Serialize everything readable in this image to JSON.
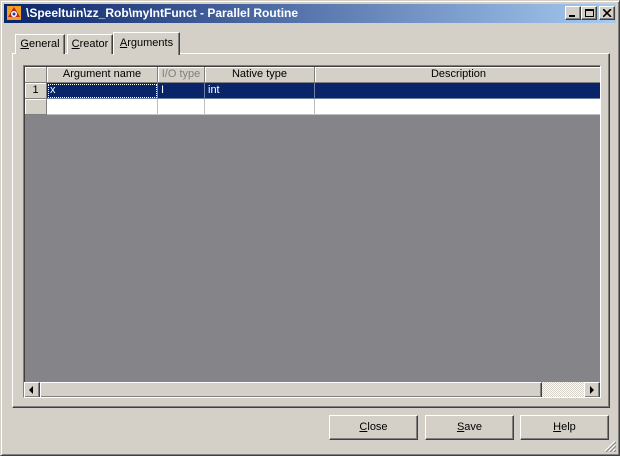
{
  "window": {
    "title": "\\Speeltuin\\zz_Rob\\myIntFunct - Parallel Routine",
    "icon": "app-icon"
  },
  "tabs": [
    {
      "label": "General",
      "accel": "G",
      "rest": "eneral",
      "active": false
    },
    {
      "label": "Creator",
      "accel": "C",
      "rest": "reator",
      "active": false
    },
    {
      "label": "Arguments",
      "accel": "A",
      "rest": "rguments",
      "active": true
    }
  ],
  "grid": {
    "columns": [
      "Argument name",
      "I/O type",
      "Native type",
      "Description"
    ],
    "rows": [
      {
        "num": "1",
        "argument_name": "x",
        "io_type": "I",
        "native_type": "int",
        "description": "",
        "selected": true
      },
      {
        "num": "",
        "argument_name": "",
        "io_type": "",
        "native_type": "",
        "description": "",
        "selected": false
      }
    ]
  },
  "buttons": [
    {
      "label": "Close",
      "accel": "C",
      "rest": "lose"
    },
    {
      "label": "Save",
      "accel": "S",
      "rest": "ave"
    },
    {
      "label": "Help",
      "accel": "H",
      "rest": "elp"
    }
  ],
  "colors": {
    "title_active": "#0a246a",
    "selection": "#0a246a",
    "grid_background": "#858489",
    "face": "#d4d0c8"
  }
}
